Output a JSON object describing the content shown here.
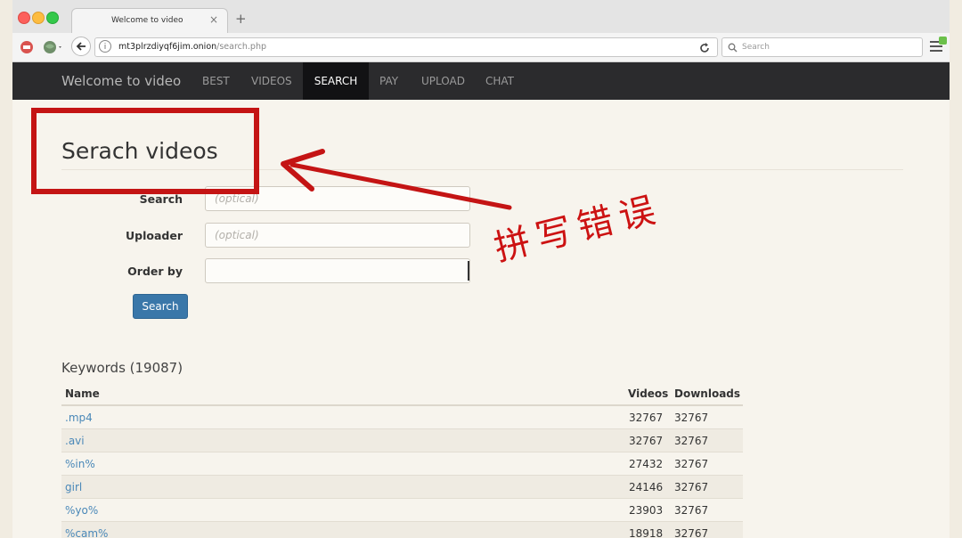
{
  "browser": {
    "tab_title": "Welcome to video",
    "tab_close": "×",
    "new_tab": "+",
    "url_host": "mt3plrzdiyqf6jim.onion",
    "url_path": "/search.php",
    "search_placeholder": "Search"
  },
  "site": {
    "brand": "Welcome to video",
    "nav": [
      {
        "label": "BEST"
      },
      {
        "label": "VIDEOS"
      },
      {
        "label": "SEARCH",
        "active": true
      },
      {
        "label": "PAY"
      },
      {
        "label": "UPLOAD"
      },
      {
        "label": "CHAT"
      }
    ]
  },
  "form": {
    "title": "Serach videos",
    "search_label": "Search",
    "search_placeholder": "(optical)",
    "uploader_label": "Uploader",
    "uploader_placeholder": "(optical)",
    "order_label": "Order by",
    "order_value": "",
    "submit_label": "Search"
  },
  "keywords": {
    "title": "Keywords (19087)",
    "columns": [
      "Name",
      "Videos",
      "Downloads"
    ],
    "rows": [
      {
        "name": ".mp4",
        "videos": "32767",
        "downloads": "32767"
      },
      {
        "name": ".avi",
        "videos": "32767",
        "downloads": "32767"
      },
      {
        "name": "%in%",
        "videos": "27432",
        "downloads": "32767"
      },
      {
        "name": "girl",
        "videos": "24146",
        "downloads": "32767"
      },
      {
        "name": "%yo%",
        "videos": "23903",
        "downloads": "32767"
      },
      {
        "name": "%cam%",
        "videos": "18918",
        "downloads": "32767"
      }
    ]
  },
  "annotation": {
    "text": "拼写错误",
    "color": "#cc1212"
  },
  "colors": {
    "navbar_bg": "#2b2b2d",
    "link": "#4a88b8",
    "button": "#3a77a9"
  }
}
